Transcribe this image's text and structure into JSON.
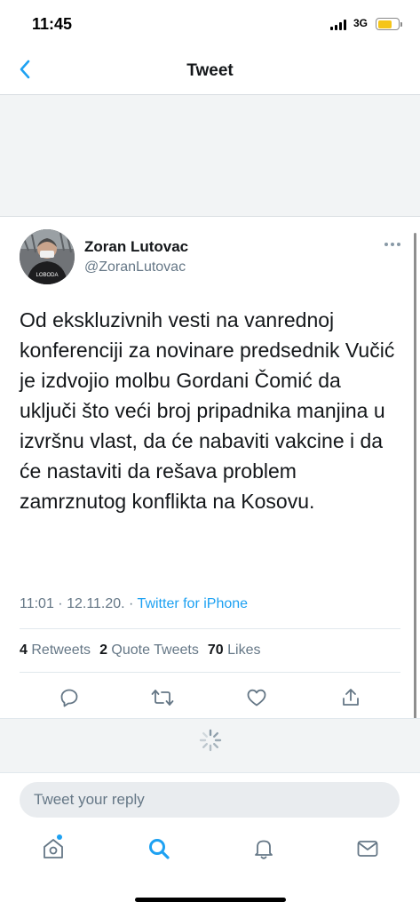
{
  "status_bar": {
    "time": "11:45",
    "network": "3G"
  },
  "nav": {
    "title": "Tweet",
    "back_icon": "chevron-left-icon"
  },
  "tweet": {
    "author_name": "Zoran Lutovac",
    "author_handle": "@ZoranLutovac",
    "avatar_label": "LOBODA",
    "text": "Od ekskluzivnih vesti na vanrednoj konferenciji za novinare predsednik Vučić je izdvojio molbu Gordani Čomić da uključi što veći broj pripadnika manjina u izvršnu vlast, da će nabaviti vakcine i da će nastaviti da rešava problem zamrznutog konflikta na Kosovu.",
    "time": "11:01 · 12.11.20. · ",
    "source": "Twitter for iPhone",
    "stats": {
      "retweets_count": "4",
      "retweets_label": "Retweets",
      "quotes_count": "2",
      "quotes_label": "Quote Tweets",
      "likes_count": "70",
      "likes_label": "Likes"
    }
  },
  "actions": [
    "reply-icon",
    "retweet-icon",
    "like-icon",
    "share-icon"
  ],
  "reply_box": {
    "placeholder": "Tweet your reply"
  },
  "tab_bar": [
    "home-icon",
    "search-icon",
    "notifications-icon",
    "messages-icon"
  ],
  "colors": {
    "accent": "#1da1f2",
    "text": "#14171a",
    "secondary": "#657786",
    "background_gray": "#f2f4f5",
    "battery": "#f5c518"
  }
}
